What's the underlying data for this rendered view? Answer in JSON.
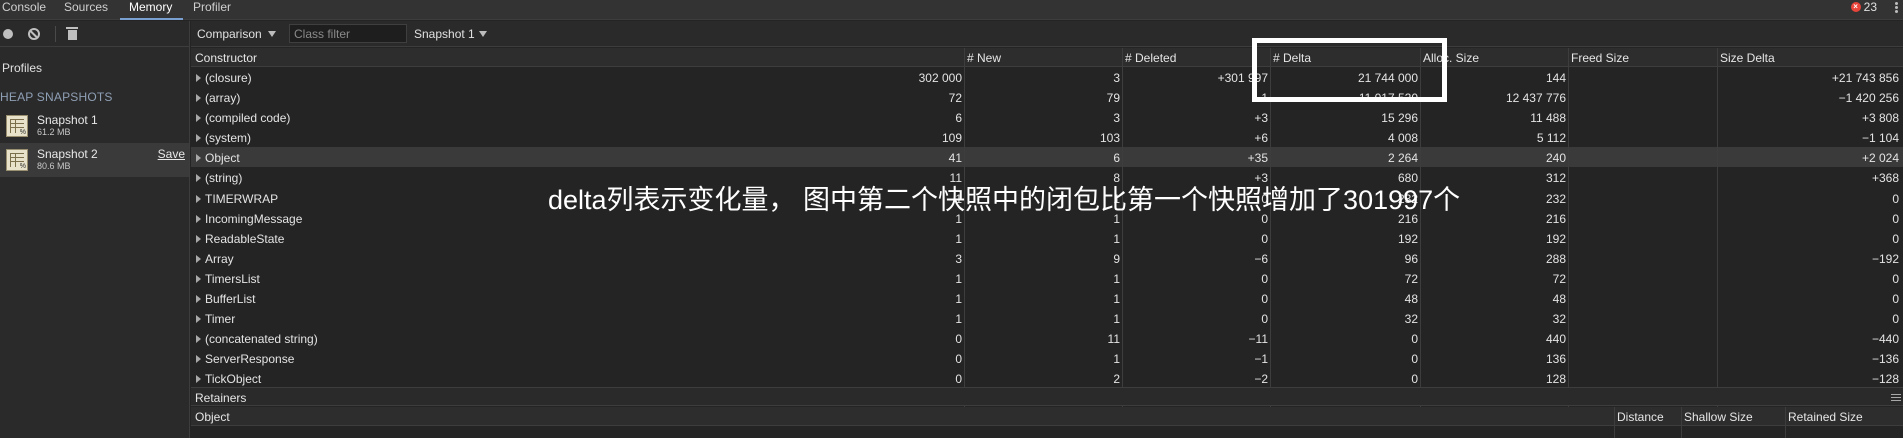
{
  "tabs": [
    "Console",
    "Sources",
    "Memory",
    "Profiler"
  ],
  "error_count": "23",
  "left_panel": {
    "profiles_title": "Profiles",
    "section_title": "HEAP SNAPSHOTS",
    "snapshots": [
      {
        "name": "Snapshot 1",
        "size": "61.2 MB"
      },
      {
        "name": "Snapshot 2",
        "size": "80.6 MB",
        "action": "Save"
      }
    ]
  },
  "toolbar": {
    "view_mode": "Comparison",
    "class_filter_placeholder": "Class filter",
    "base_snapshot": "Snapshot 1"
  },
  "table": {
    "headers": [
      "Constructor",
      "# New",
      "# Deleted",
      "# Delta",
      "Alloc. Size",
      "Freed Size",
      "Size Delta"
    ],
    "rows": [
      [
        "(closure)",
        "302 000",
        "3",
        "+301 997",
        "21 744 000",
        "144",
        "+21 743 856"
      ],
      [
        "(array)",
        "72",
        "79",
        "−1",
        "11 017 520",
        "12 437 776",
        "−1 420 256"
      ],
      [
        "(compiled code)",
        "6",
        "3",
        "+3",
        "15 296",
        "11 488",
        "+3 808"
      ],
      [
        "(system)",
        "109",
        "103",
        "+6",
        "4 008",
        "5 112",
        "−1 104"
      ],
      [
        "Object",
        "41",
        "6",
        "+35",
        "2 264",
        "240",
        "+2 024"
      ],
      [
        "(string)",
        "11",
        "8",
        "+3",
        "680",
        "312",
        "+368"
      ],
      [
        "TIMERWRAP",
        "1",
        "1",
        "0",
        "232",
        "232",
        "0"
      ],
      [
        "IncomingMessage",
        "1",
        "1",
        "0",
        "216",
        "216",
        "0"
      ],
      [
        "ReadableState",
        "1",
        "1",
        "0",
        "192",
        "192",
        "0"
      ],
      [
        "Array",
        "3",
        "9",
        "−6",
        "96",
        "288",
        "−192"
      ],
      [
        "TimersList",
        "1",
        "1",
        "0",
        "72",
        "72",
        "0"
      ],
      [
        "BufferList",
        "1",
        "1",
        "0",
        "48",
        "48",
        "0"
      ],
      [
        "Timer",
        "1",
        "1",
        "0",
        "32",
        "32",
        "0"
      ],
      [
        "(concatenated string)",
        "0",
        "11",
        "−11",
        "0",
        "440",
        "−440"
      ],
      [
        "ServerResponse",
        "0",
        "1",
        "−1",
        "0",
        "136",
        "−136"
      ],
      [
        "TickObject",
        "0",
        "2",
        "−2",
        "0",
        "128",
        "−128"
      ]
    ],
    "highlighted_row": 4
  },
  "retainers": {
    "title": "Retainers",
    "headers": [
      "Object",
      "Distance",
      "Shallow Size",
      "Retained Size"
    ]
  },
  "annotation": {
    "caption": "delta列表示变化量， 图中第二个快照中的闭包比第一个快照增加了301997个"
  }
}
